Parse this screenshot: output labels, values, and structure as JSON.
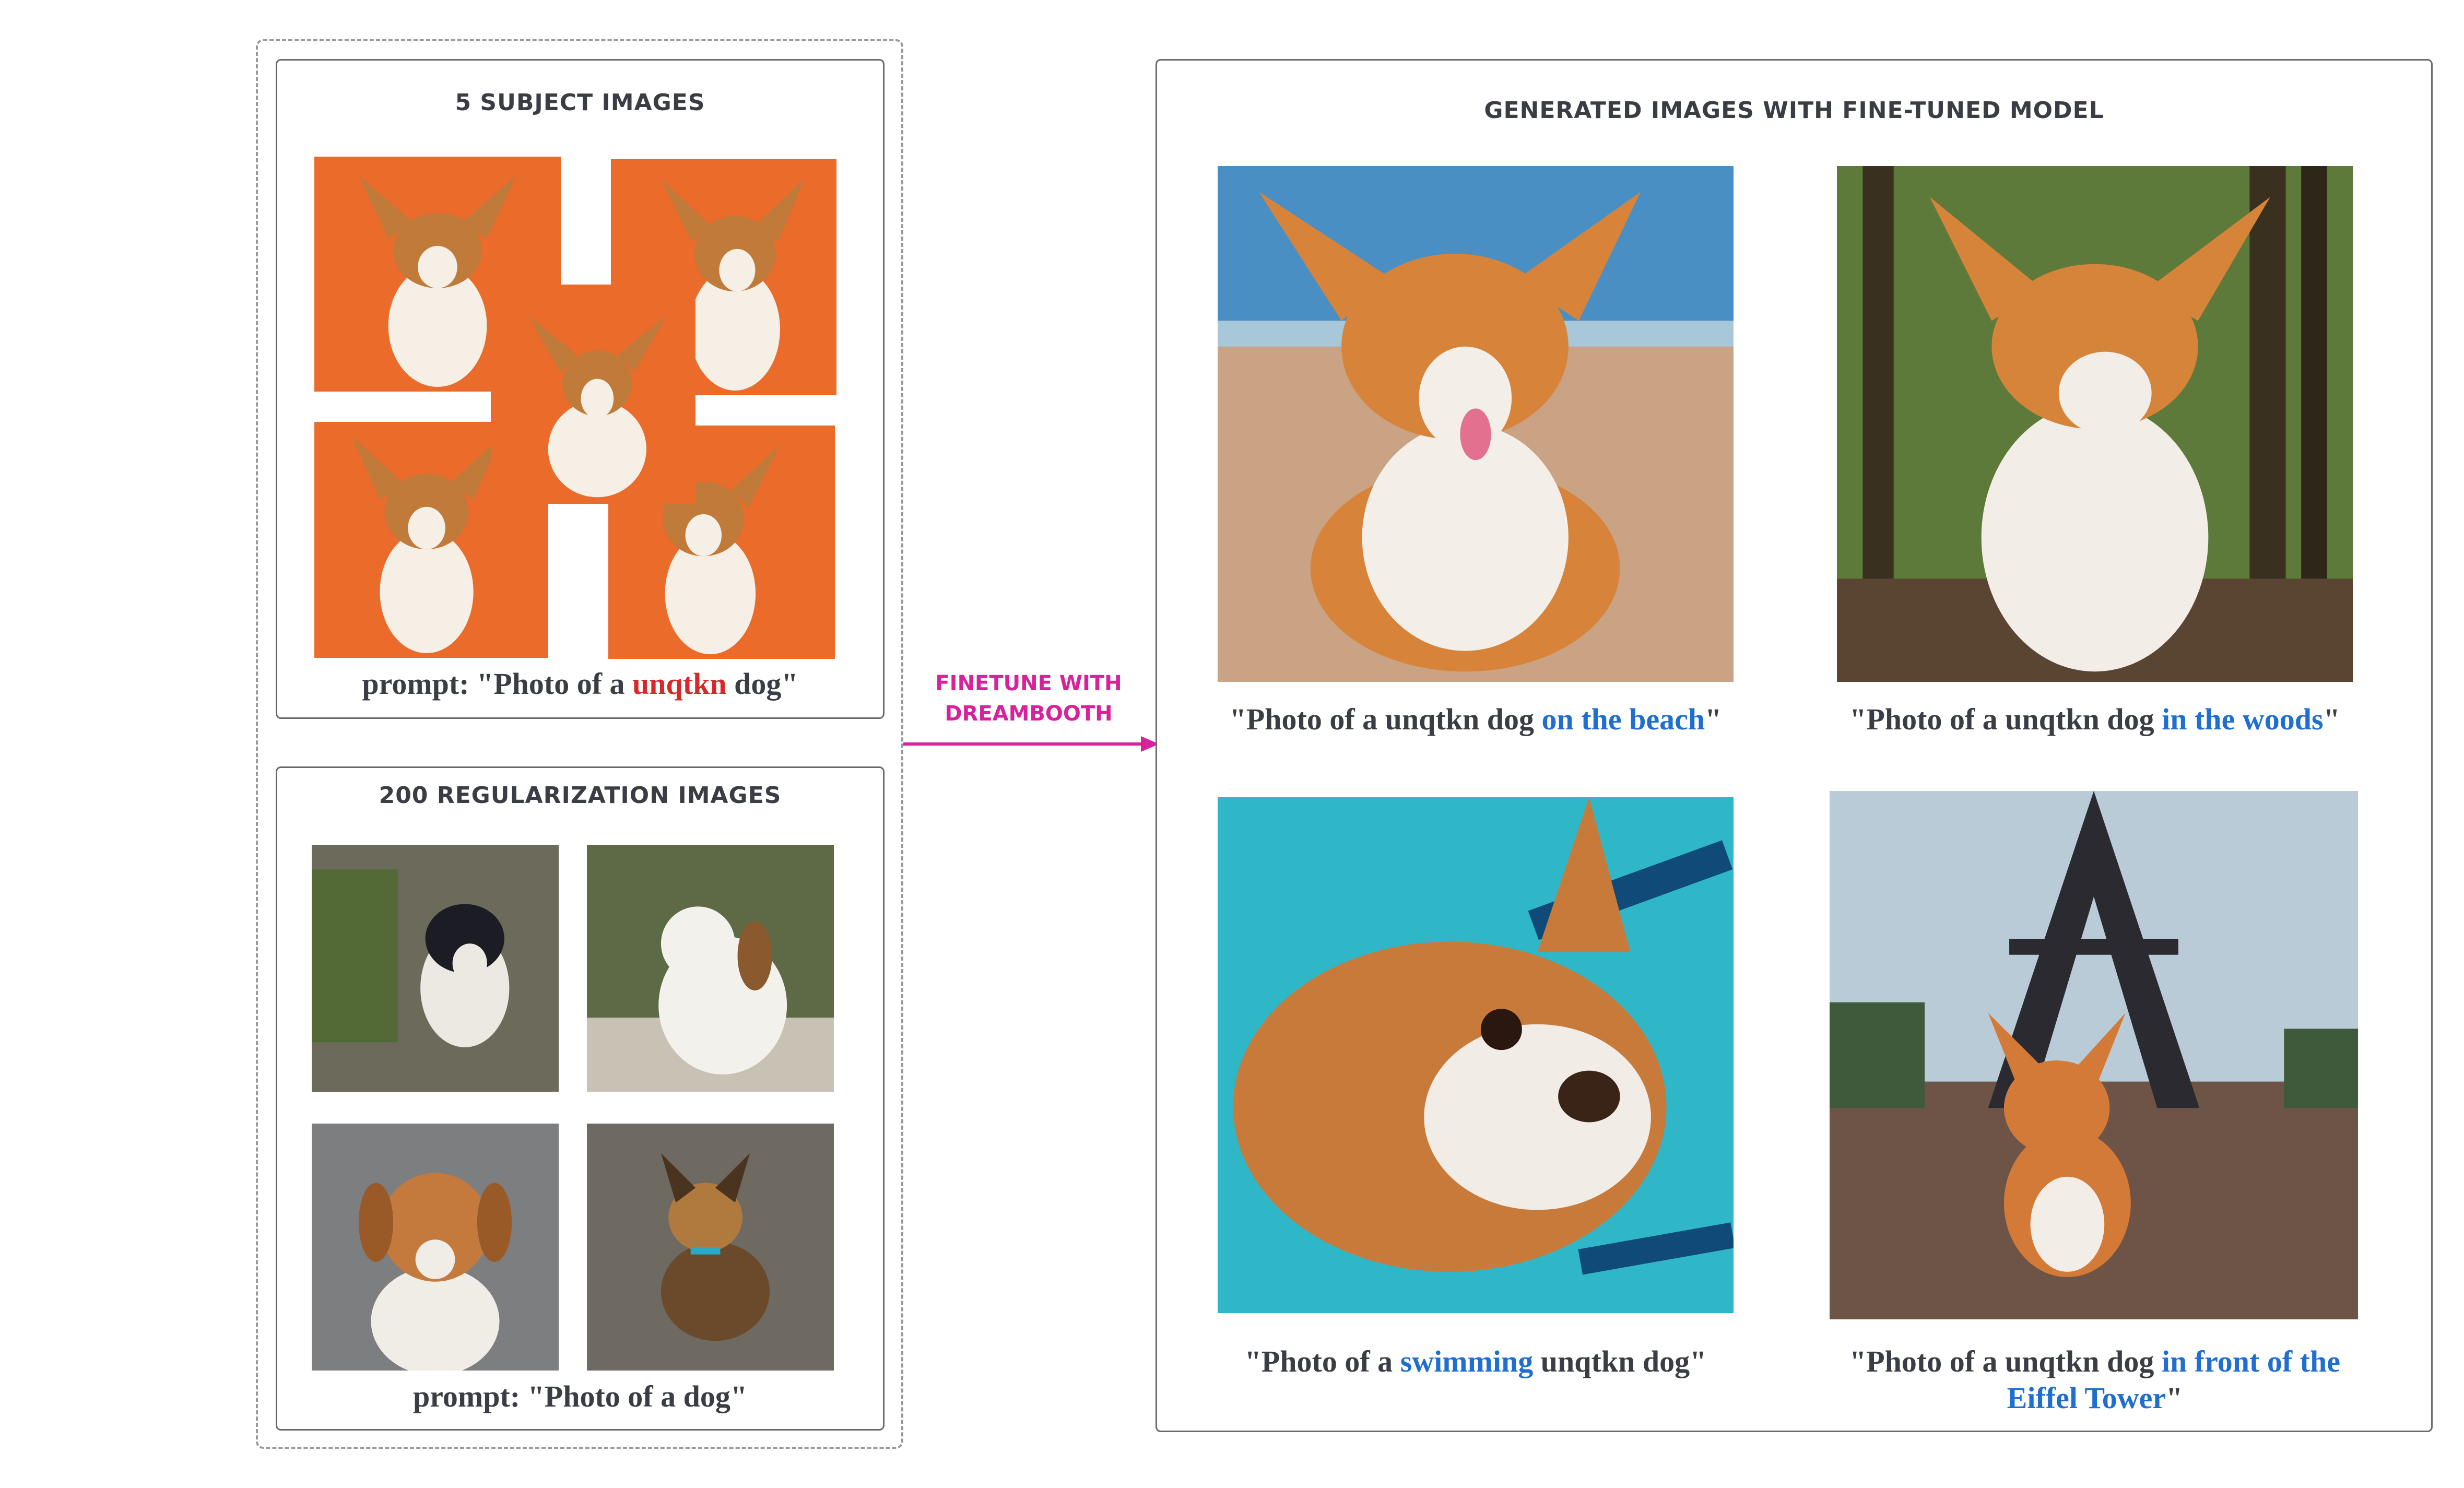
{
  "subject_panel": {
    "title": "5 SUBJECT IMAGES",
    "caption_prefix": "prompt: \"Photo of a ",
    "caption_token": "unqtkn",
    "caption_suffix": " dog\""
  },
  "regularization_panel": {
    "title": "200 REGULARIZATION IMAGES",
    "caption": "prompt: \"Photo of a dog\""
  },
  "arrow": {
    "line1": "FINETUNE WITH",
    "line2": "DREAMBOOTH"
  },
  "generated_panel": {
    "title": "GENERATED IMAGES WITH FINE-TUNED MODEL",
    "images": [
      {
        "prefix": "\"Photo of a unqtkn dog ",
        "highlight": "on the beach",
        "suffix": "\""
      },
      {
        "prefix": "\"Photo of a unqtkn dog ",
        "highlight": "in the woods",
        "suffix": "\""
      },
      {
        "prefix": "\"Photo of a ",
        "highlight": "swimming",
        "suffix": " unqtkn dog\""
      },
      {
        "prefix": "\"Photo of a unqtkn dog ",
        "highlight": "in front of the",
        "line2_highlight": "Eiffel Tower",
        "suffix": "\""
      }
    ]
  },
  "colors": {
    "arrow": "#d8229c",
    "token_red": "#d42a2a",
    "highlight_blue": "#1f6fd0",
    "subject_background": "#ea6b2a"
  }
}
